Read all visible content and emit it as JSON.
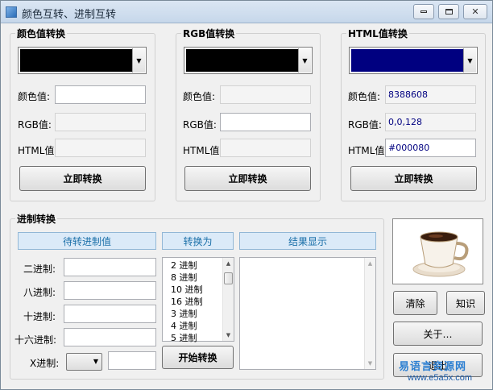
{
  "window": {
    "title": "颜色互转、进制互转"
  },
  "color_to_value": {
    "title": "颜色值转换",
    "swatch_color": "#000000",
    "labels": {
      "color_value": "颜色值:",
      "rgb": "RGB值:",
      "html": "HTML值:"
    },
    "values": {
      "color_value": "",
      "rgb": "",
      "html": ""
    },
    "button": "立即转换"
  },
  "rgb_to_color": {
    "title": "RGB值转换",
    "swatch_color": "#000000",
    "labels": {
      "color_value": "颜色值:",
      "rgb": "RGB值:",
      "html": "HTML值:"
    },
    "values": {
      "color_value": "",
      "rgb": "",
      "html": ""
    },
    "button": "立即转换"
  },
  "html_to_color": {
    "title": "HTML值转换",
    "swatch_color": "#000080",
    "labels": {
      "color_value": "颜色值:",
      "rgb": "RGB值:",
      "html": "HTML值:"
    },
    "values": {
      "color_value": "8388608",
      "rgb": "0,0,128",
      "html": "#000080"
    },
    "button": "立即转换"
  },
  "base_convert": {
    "title": "进制转换",
    "headers": {
      "source": "待转进制值",
      "target": "转换为",
      "result": "结果显示"
    },
    "labels": {
      "bin": "二进制:",
      "oct": "八进制:",
      "dec": "十进制:",
      "hex": "十六进制:",
      "x": "X进制:"
    },
    "base_options": [
      "2 进制",
      "8 进制",
      "10 进制",
      "16 进制",
      "3 进制",
      "4 进制",
      "5 进制"
    ],
    "start_button": "开始转换"
  },
  "side_buttons": {
    "clear": "清除",
    "knowledge": "知识",
    "about": "关于…",
    "exit": "退出"
  },
  "watermark": {
    "text": "易语言资源网",
    "url": "www.e5a5x.com"
  }
}
